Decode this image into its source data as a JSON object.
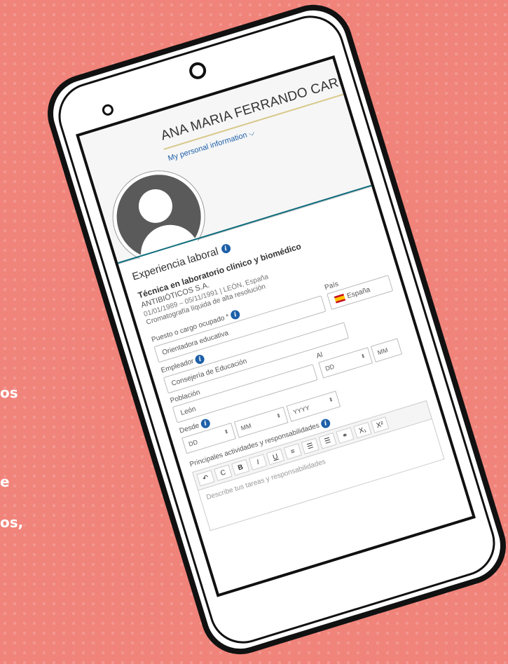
{
  "side_text": [
    "os",
    "e",
    "os,"
  ],
  "profile": {
    "name": "ANA MARIA FERRANDO CARRETERO",
    "personal_link": "My personal information ⌵"
  },
  "experience": {
    "section_title": "Experiencia laboral",
    "job_title": "Técnica en laboratorio clínico y biomédico",
    "company": "ANTIBIÓTICOS S.A.",
    "dates_location": "01/01/1989 – 05/11/1991 | LEÓN, España",
    "description": "Cromatografía líquida de alta resolución"
  },
  "form": {
    "position_label": "Puesto o cargo ocupado *",
    "position_value": "Orientadora educativa",
    "country_label": "País",
    "country_value": "España",
    "employer_label": "Empleador",
    "employer_value": "Consejería de Educación",
    "city_label": "Población",
    "city_value": "León",
    "to_label": "Al",
    "from_label": "Desde",
    "date_dd": "DD",
    "date_mm": "MM",
    "date_yyyy": "YYYY",
    "activities_label": "Principales actividades y responsabilidades",
    "editor_placeholder": "Describe tus tareas y responsabilidades"
  },
  "toolbar": {
    "undo": "↶",
    "redo": "C",
    "bold": "B",
    "italic": "I",
    "underline": "U",
    "align": "≡",
    "ordered_list": "☰",
    "bullet_list": "☰",
    "link": "⚭",
    "subscript": "X₁",
    "superscript": "X²"
  }
}
